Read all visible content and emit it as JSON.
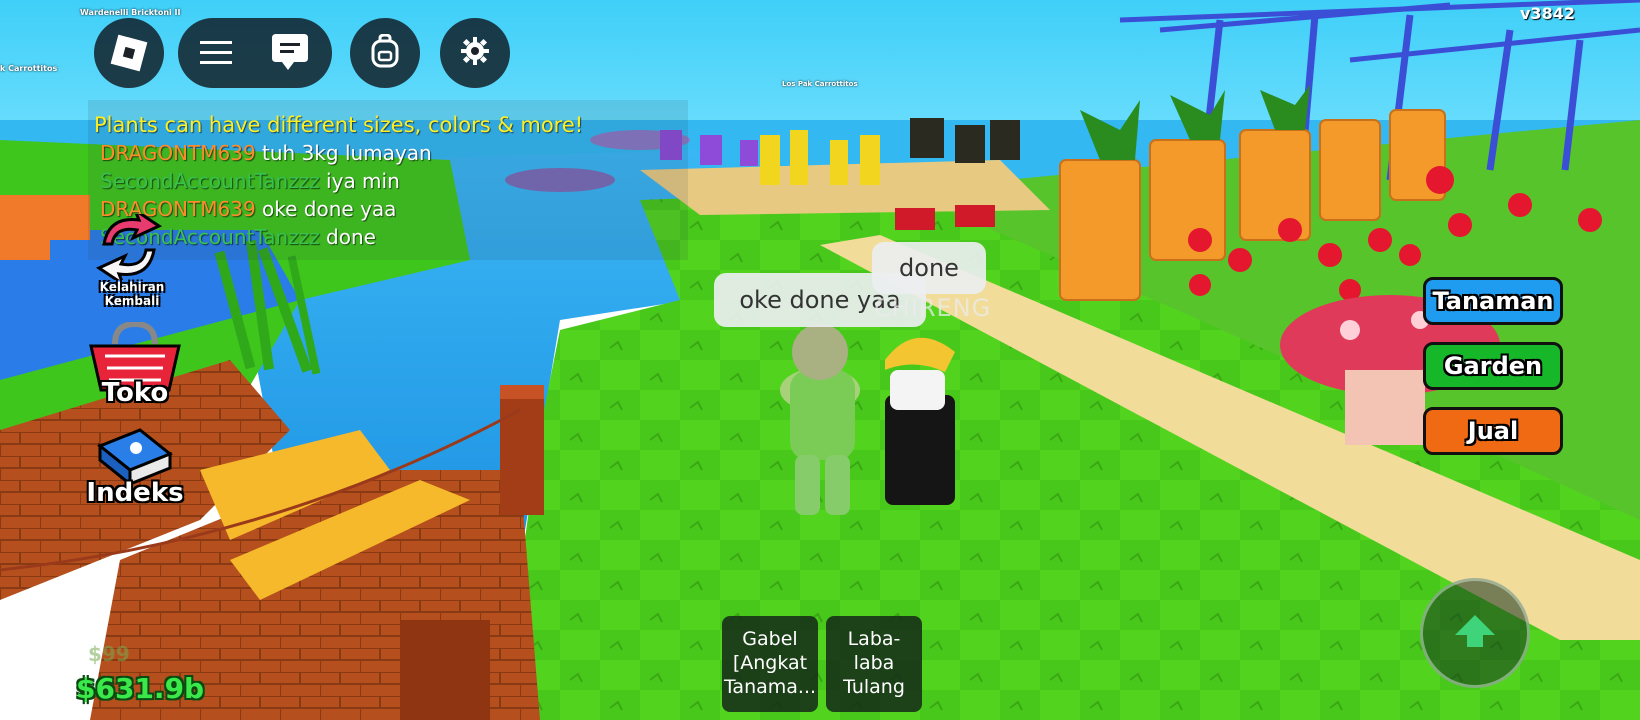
{
  "version": "v3842",
  "chat": [
    {
      "name": "",
      "message": "Plants can have different sizes, colors & more!",
      "color": "#ffee22"
    },
    {
      "name": "DRAGONTM639",
      "message": "tuh 3kg lumayan",
      "color": "#ff8a2a"
    },
    {
      "name": "SecondAccountTanzzz",
      "message": "iya min",
      "color": "#39c14e"
    },
    {
      "name": "DRAGONTM639",
      "message": "oke done yaa",
      "color": "#ff8a2a"
    },
    {
      "name": "SecondAccountTanzzz",
      "message": "done",
      "color": "#39c14e"
    }
  ],
  "side_buttons": {
    "rebirth": "Kelahiran Kembali",
    "shop": "Toko",
    "index": "Indeks"
  },
  "right_buttons": [
    {
      "label": "Tanaman",
      "color": "#1f9bf0"
    },
    {
      "label": "Garden",
      "color": "#16b82a"
    },
    {
      "label": "Jual",
      "color": "#f06a14"
    }
  ],
  "bubbles": {
    "player1": "oke done yaa",
    "player2": "done",
    "player2_name": "CHIRENG"
  },
  "money": {
    "faded": "$99",
    "amount": "$631.9b"
  },
  "hotbar": [
    {
      "label": "Gabel [Angkat Tanama..."
    },
    {
      "label": "Laba-laba Tulang"
    }
  ],
  "world_labels": {
    "top_left_sign": "Wardenelli Bricktoni II",
    "left_sign": "k Carrottitos",
    "center_sign": "Los Pak Carrottitos"
  },
  "icons": {
    "roblox": "roblox-logo-icon",
    "menu": "hamburger-menu-icon",
    "chat": "chat-icon",
    "backpack": "backpack-icon",
    "settings": "gear-icon",
    "jump": "jump-arrow-icon"
  },
  "colors": {
    "grass": "#4fcf1e",
    "water": "#2aa8f0",
    "sky": "#5fd6ff"
  }
}
